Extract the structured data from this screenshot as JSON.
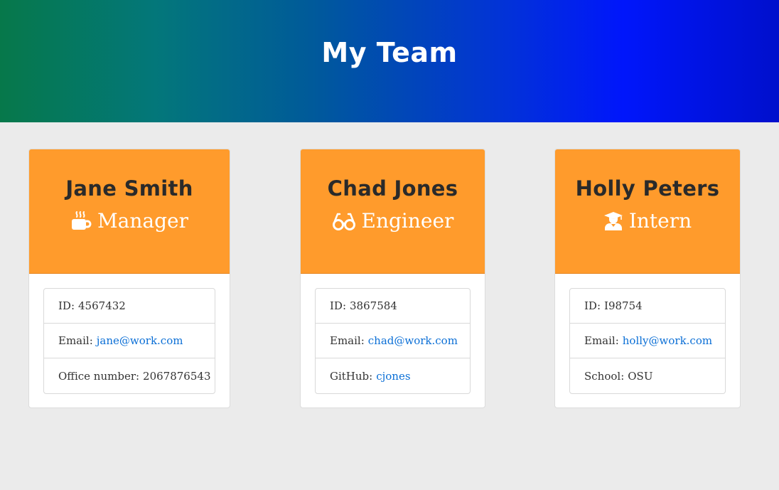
{
  "header": {
    "title": "My Team"
  },
  "team": [
    {
      "name": "Jane Smith",
      "role": "Manager",
      "role_icon": "mug-icon",
      "id_label": "ID:",
      "id": "4567432",
      "email_label": "Email:",
      "email": "jane@work.com",
      "extra_label": "Office number:",
      "extra_value": "2067876543",
      "extra_is_link": false
    },
    {
      "name": "Chad Jones",
      "role": "Engineer",
      "role_icon": "glasses-icon",
      "id_label": "ID:",
      "id": "3867584",
      "email_label": "Email:",
      "email": "chad@work.com",
      "extra_label": "GitHub:",
      "extra_value": "cjones",
      "extra_is_link": true
    },
    {
      "name": "Holly Peters",
      "role": "Intern",
      "role_icon": "graduate-icon",
      "id_label": "ID:",
      "id": "I98754",
      "email_label": "Email:",
      "email": "holly@work.com",
      "extra_label": "School:",
      "extra_value": "OSU",
      "extra_is_link": false
    }
  ],
  "colors": {
    "card_header": "#ff9b2c",
    "link": "#0b6fd6",
    "background": "#ebebeb"
  }
}
